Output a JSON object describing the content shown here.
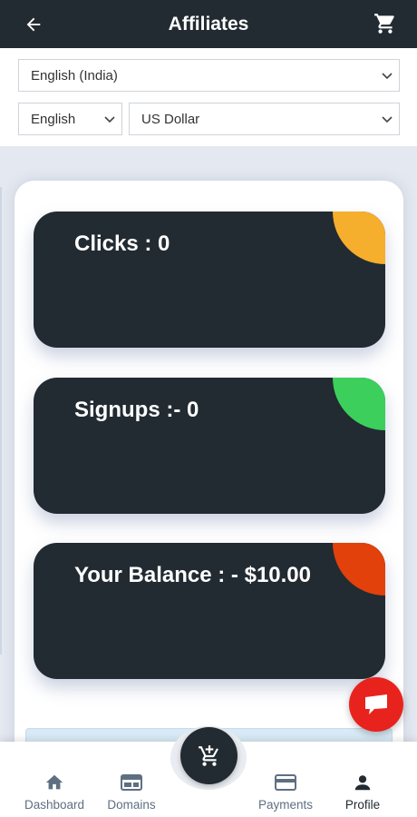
{
  "header": {
    "title": "Affiliates",
    "back_icon": "arrow-left-icon",
    "cart_icon": "cart-icon"
  },
  "selects": {
    "country": "English (India)",
    "language": "English",
    "currency": "US Dollar"
  },
  "stats": [
    {
      "label": "Clicks : 0",
      "corner_color": "#f6ae2d"
    },
    {
      "label": "Signups :- 0",
      "corner_color": "#3ccf5c"
    },
    {
      "label": "Your Balance : - $10.00",
      "corner_color": "#e2410c"
    }
  ],
  "chat": {
    "icon": "chat-icon",
    "color": "#e8231d"
  },
  "fab": {
    "icon": "add-to-cart-icon"
  },
  "bottom_nav": {
    "items": [
      {
        "label": "Dashboard",
        "icon": "home-icon"
      },
      {
        "label": "Domains",
        "icon": "browser-window-icon"
      },
      {
        "label": "Payments",
        "icon": "credit-card-icon"
      },
      {
        "label": "Profile",
        "icon": "person-icon",
        "active": true
      }
    ]
  },
  "colors": {
    "header_bg": "#222b32",
    "card_bg": "#222b32",
    "nav_inactive": "#5f6f82"
  }
}
